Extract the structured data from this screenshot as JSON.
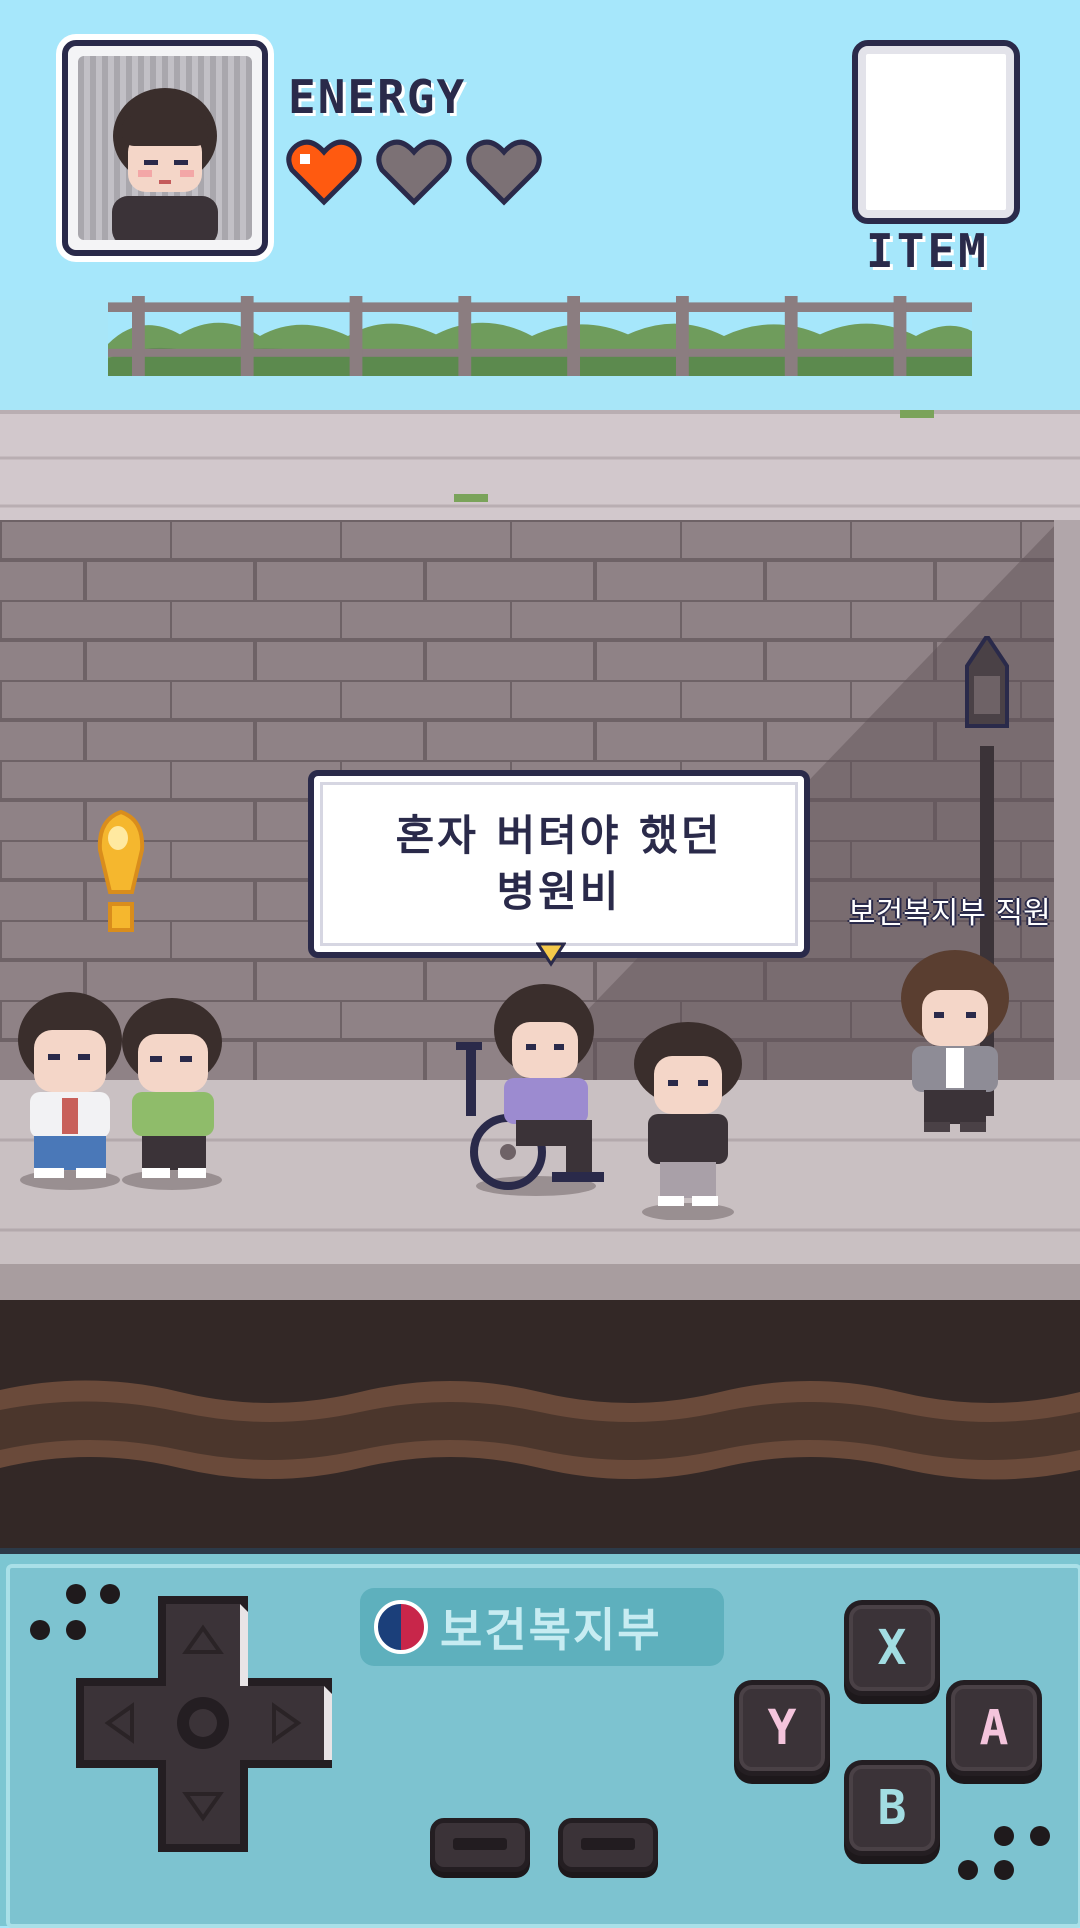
{
  "hud": {
    "energy_label": "ENERGY",
    "energy": {
      "current": 1,
      "max": 3
    },
    "item_label": "ITEM",
    "icons": {
      "portrait": "player-portrait",
      "heart": "heart-icon",
      "item": "item-slot"
    }
  },
  "scene": {
    "speech_bubble": {
      "line1": "혼자 버텨야 했던",
      "line2": "병원비"
    },
    "npc_label": "보건복지부 직원",
    "exclamation": "!"
  },
  "controller": {
    "brand_text": "보건복지부",
    "buttons": {
      "x": "X",
      "y": "Y",
      "a": "A",
      "b": "B"
    },
    "dpad": "dpad",
    "select_label": "",
    "start_label": ""
  },
  "colors": {
    "sky": "#a6e7fb",
    "heart_full": "#ff5a10",
    "heart_empty": "#7c7175",
    "outline": "#2a2a4a",
    "controller_bg": "#7dc3d0",
    "btn_x": "#a2dde2",
    "btn_y": "#f4c4dc",
    "btn_a": "#f4c4dc",
    "btn_b": "#a2dde2"
  }
}
